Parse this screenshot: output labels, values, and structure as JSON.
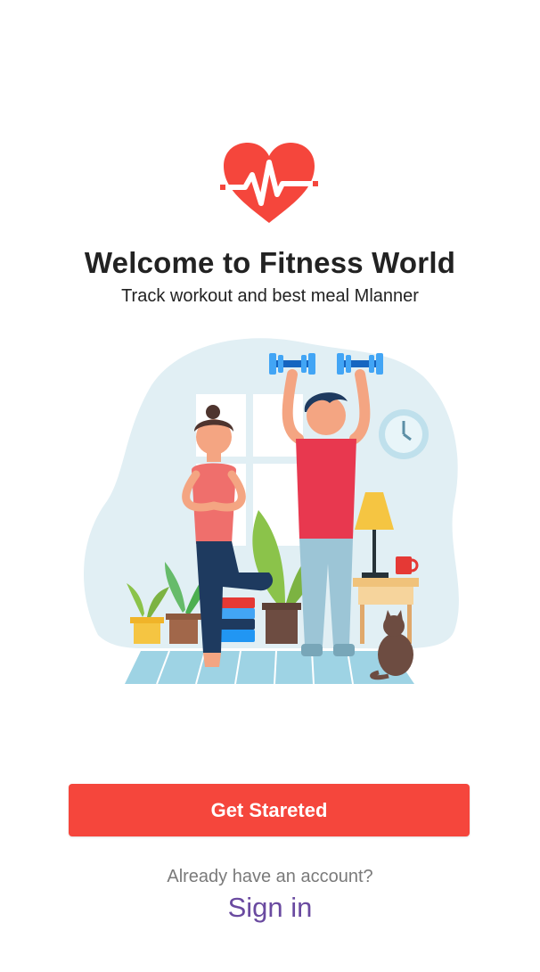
{
  "header": {
    "logo_icon": "heart-pulse-icon",
    "title": "Welcome to Fitness World",
    "subtitle": "Track workout and best meal Mlanner"
  },
  "illustration": {
    "name": "home-workout-illustration"
  },
  "actions": {
    "primary_label": "Get Stareted",
    "account_prompt": "Already have an account?",
    "signin_label": "Sign in"
  },
  "colors": {
    "primary": "#f5463c",
    "link": "#6a4aa0",
    "heading": "#222222",
    "muted": "#7a7a7a"
  }
}
